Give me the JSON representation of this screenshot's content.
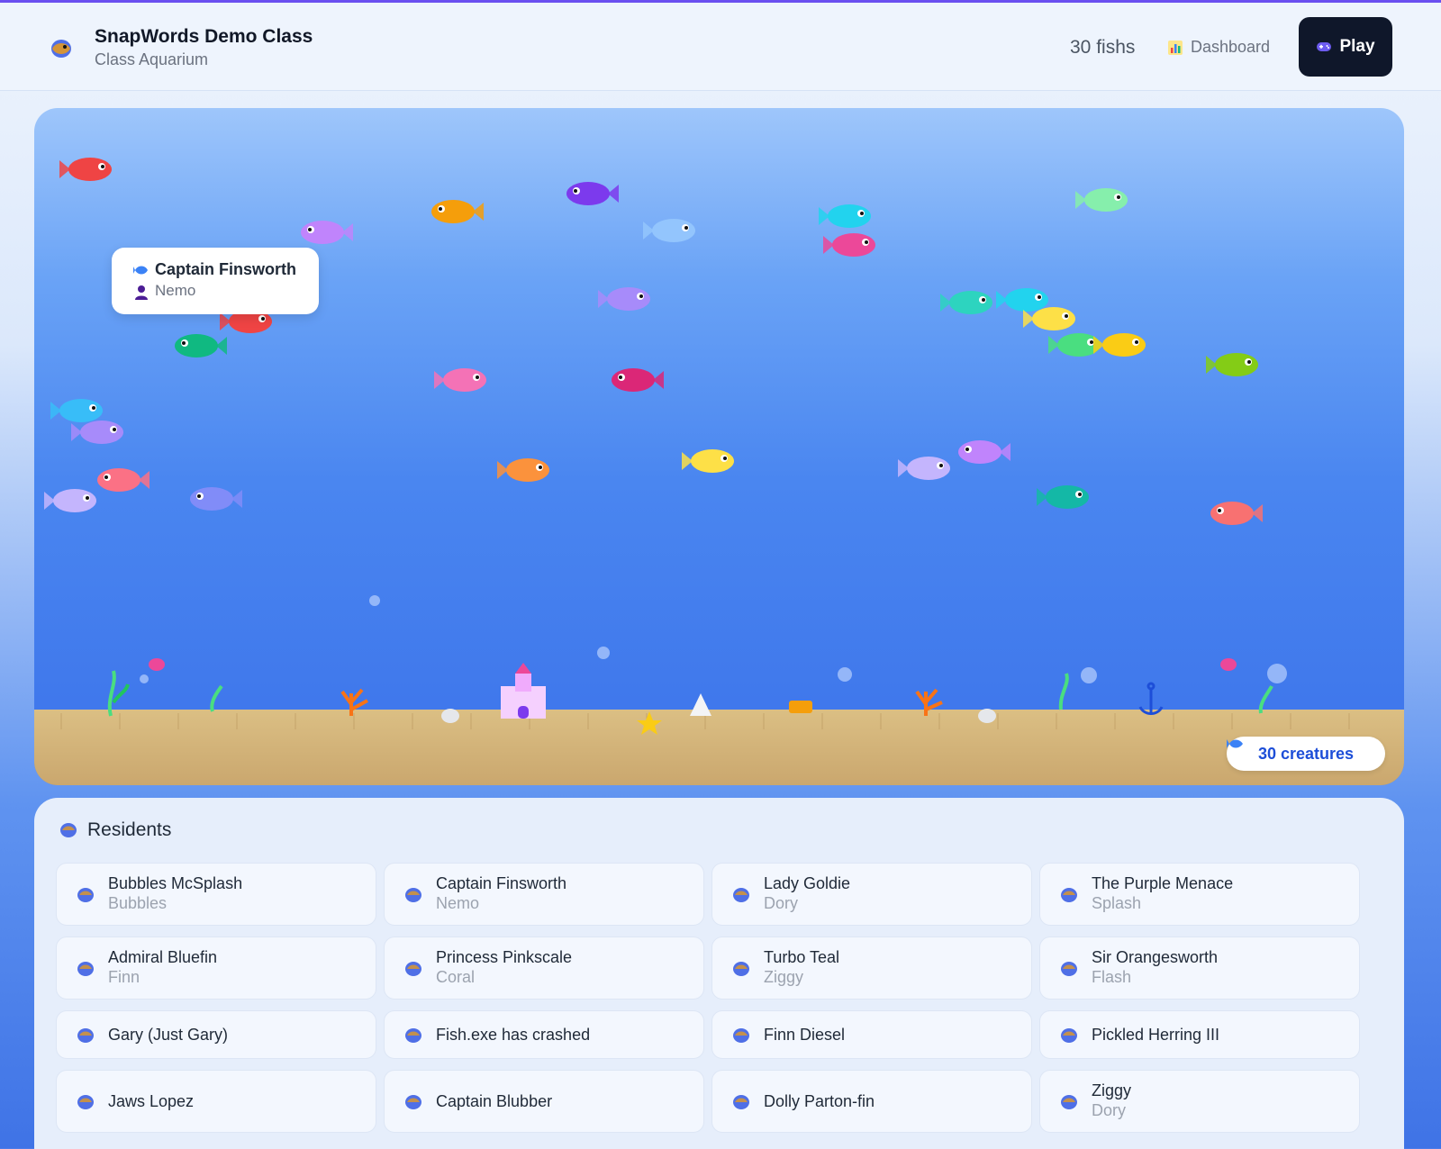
{
  "app": {
    "class_title": "SnapWords Demo Class",
    "class_subtitle": "Class Aquarium",
    "fish_count": "30 fishs",
    "dashboard_label": "Dashboard",
    "play_label": "Play",
    "accent_color": "#6a4ff0"
  },
  "aquarium": {
    "tooltip": {
      "name": "Captain Finsworth",
      "owner": "Nemo"
    },
    "creatures_badge": "30 creatures"
  },
  "residents": {
    "heading": "Residents",
    "items": [
      {
        "name": "Bubbles McSplash",
        "owner": "Bubbles"
      },
      {
        "name": "Captain Finsworth",
        "owner": "Nemo"
      },
      {
        "name": "Lady Goldie",
        "owner": "Dory"
      },
      {
        "name": "The Purple Menace",
        "owner": "Splash"
      },
      {
        "name": "Admiral Bluefin",
        "owner": "Finn"
      },
      {
        "name": "Princess Pinkscale",
        "owner": "Coral"
      },
      {
        "name": "Turbo Teal",
        "owner": "Ziggy"
      },
      {
        "name": "Sir Orangesworth",
        "owner": "Flash"
      },
      {
        "name": "Gary (Just Gary)",
        "owner": ""
      },
      {
        "name": "Fish.exe has crashed",
        "owner": ""
      },
      {
        "name": "Finn Diesel",
        "owner": ""
      },
      {
        "name": "Pickled Herring III",
        "owner": ""
      },
      {
        "name": "Jaws Lopez",
        "owner": ""
      },
      {
        "name": "Captain Blubber",
        "owner": ""
      },
      {
        "name": "Dolly Parton-fin",
        "owner": ""
      },
      {
        "name": "Ziggy",
        "owner": "Dory"
      }
    ]
  }
}
